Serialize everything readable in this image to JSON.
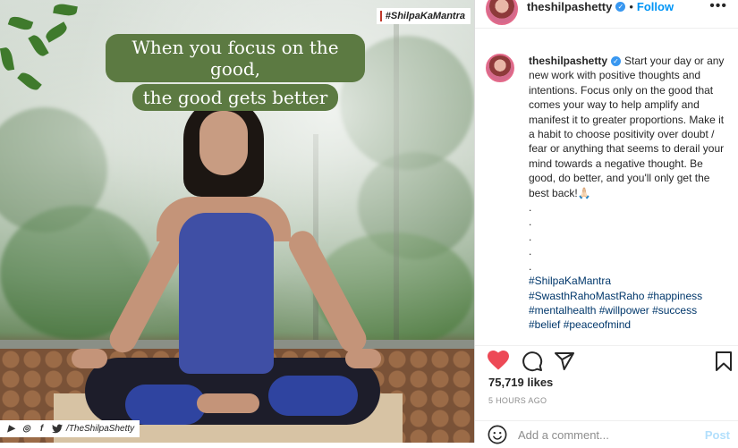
{
  "image": {
    "hashtag_tag": "#ShilpaKaMantra",
    "quote_line1": "When you focus on the good,",
    "quote_line2": "the good gets better",
    "handle": "/TheShilpaShetty"
  },
  "header": {
    "username": "theshilpashetty",
    "separator": "•",
    "follow_label": "Follow",
    "more_label": "•••"
  },
  "caption": {
    "username": "theshilpashetty",
    "text": "Start your day or any new work with positive thoughts and intentions. Focus only on the good that comes your way to help amplify and manifest it to greater proportions. Make it a habit to choose positivity over doubt / fear or anything that seems to derail your mind towards a negative thought. Be good, do better, and you'll only get the best back!🙏🏻",
    "dots": [
      ".",
      ".",
      ".",
      ".",
      "."
    ],
    "hashtags": [
      "#ShilpaKaMantra",
      "#SwasthRahoMastRaho #happiness",
      "#mentalhealth #willpower #success",
      "#belief #peaceofmind"
    ]
  },
  "stats": {
    "likes": "75,719 likes",
    "time": "5 HOURS AGO"
  },
  "comment": {
    "placeholder": "Add a comment...",
    "post_label": "Post"
  },
  "colors": {
    "like_red": "#ed4956",
    "link_blue": "#0095f6",
    "hashtag_blue": "#00376b",
    "verified_blue": "#3897f0"
  },
  "icons": [
    "heart-icon",
    "comment-icon",
    "share-icon",
    "bookmark-icon",
    "more-icon",
    "verified-icon",
    "emoji-icon",
    "instagram-icon",
    "facebook-icon",
    "twitter-icon"
  ]
}
